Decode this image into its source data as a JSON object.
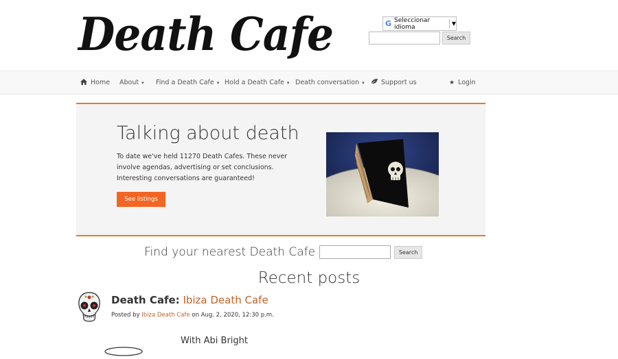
{
  "header": {
    "logo_text": "Death Cafe",
    "translate_label": "Seleccionar idioma",
    "translate_caret": "▼",
    "search_button": "Search",
    "search_value": ""
  },
  "nav": {
    "items": [
      {
        "label": "Home",
        "icon": "home-icon",
        "has_dropdown": false
      },
      {
        "label": "About",
        "has_dropdown": true
      },
      {
        "label": "Find a Death Cafe",
        "has_dropdown": true
      },
      {
        "label": "Hold a Death Cafe",
        "has_dropdown": true
      },
      {
        "label": "Death conversation",
        "has_dropdown": true
      },
      {
        "label": "Support us",
        "icon": "leaf-icon",
        "has_dropdown": false
      },
      {
        "label": "Login",
        "icon": "star-icon",
        "has_dropdown": false
      }
    ]
  },
  "hero": {
    "title": "Talking about death",
    "text": "To date we've held 11270 Death Cafes. These never involve agendas, advertising or set conclusions. Interesting conversations are guaranteed!",
    "button_label": "See listings",
    "image_alt": "slice of black cake with skull"
  },
  "find": {
    "label": "Find your nearest Death Cafe",
    "button_label": "Search",
    "input_value": ""
  },
  "recent": {
    "heading": "Recent posts",
    "posts": [
      {
        "title_prefix": "Death Cafe:",
        "title_link": "Ibiza Death Cafe",
        "posted_by_label": "Posted by",
        "author": "Ibiza Death Cafe",
        "date_text": "on Aug. 2, 2020, 12:30 p.m.",
        "subtitle": "With Abi Bright"
      }
    ]
  },
  "colors": {
    "accent": "#f26522",
    "border_accent": "#e07b27",
    "link": "#c0642a",
    "navbar_bg": "#f8f8f8",
    "jumbotron_bg": "#f4f4f4"
  }
}
